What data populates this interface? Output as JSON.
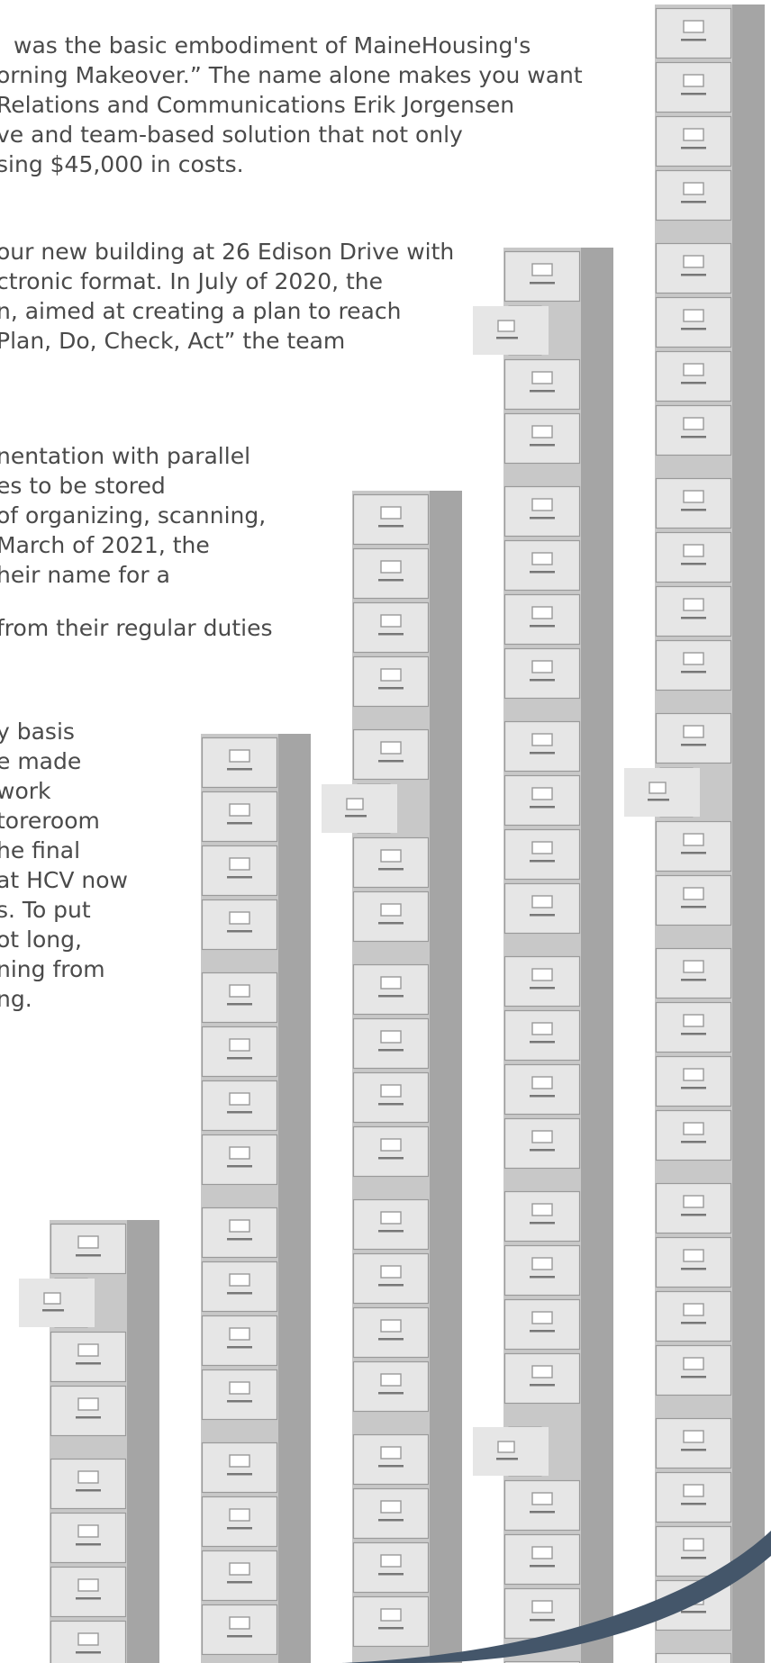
{
  "article": {
    "paragraphs": [
      {
        "lines": [
          "was the basic embodiment of MaineHousing's",
          "orning Makeover.” The name alone makes you want",
          "Relations and Communications Erik Jorgensen",
          "ve and team-based solution that not only",
          "sing $45,000 in costs."
        ]
      },
      {
        "lines": [
          "our new building at 26 Edison Drive with",
          "ctronic format.  In July of 2020, the",
          "n, aimed at creating a plan to reach",
          "Plan, Do, Check, Act”  the team"
        ]
      },
      {
        "lines": [
          "nentation with parallel",
          "es to be stored",
          "of organizing, scanning,",
          " March of 2021, the",
          "heir name for a",
          " from their regular duties"
        ]
      },
      {
        "lines": [
          "y basis",
          "e made",
          "work",
          "toreroom",
          "he final",
          "at HCV now",
          "s.  To put",
          "ot long,",
          "ning from",
          "ng."
        ]
      }
    ]
  },
  "illustration": {
    "subject": "filing-cabinet-stacks",
    "colors": {
      "drawer_face": "#e6e6e6",
      "drawer_border": "#9a9a9a",
      "cabinet_side": "#a5a5a5",
      "cabinet_gap": "#c8c8c8",
      "open_folder": "#f1e6a8",
      "wave": "#44566a"
    }
  }
}
